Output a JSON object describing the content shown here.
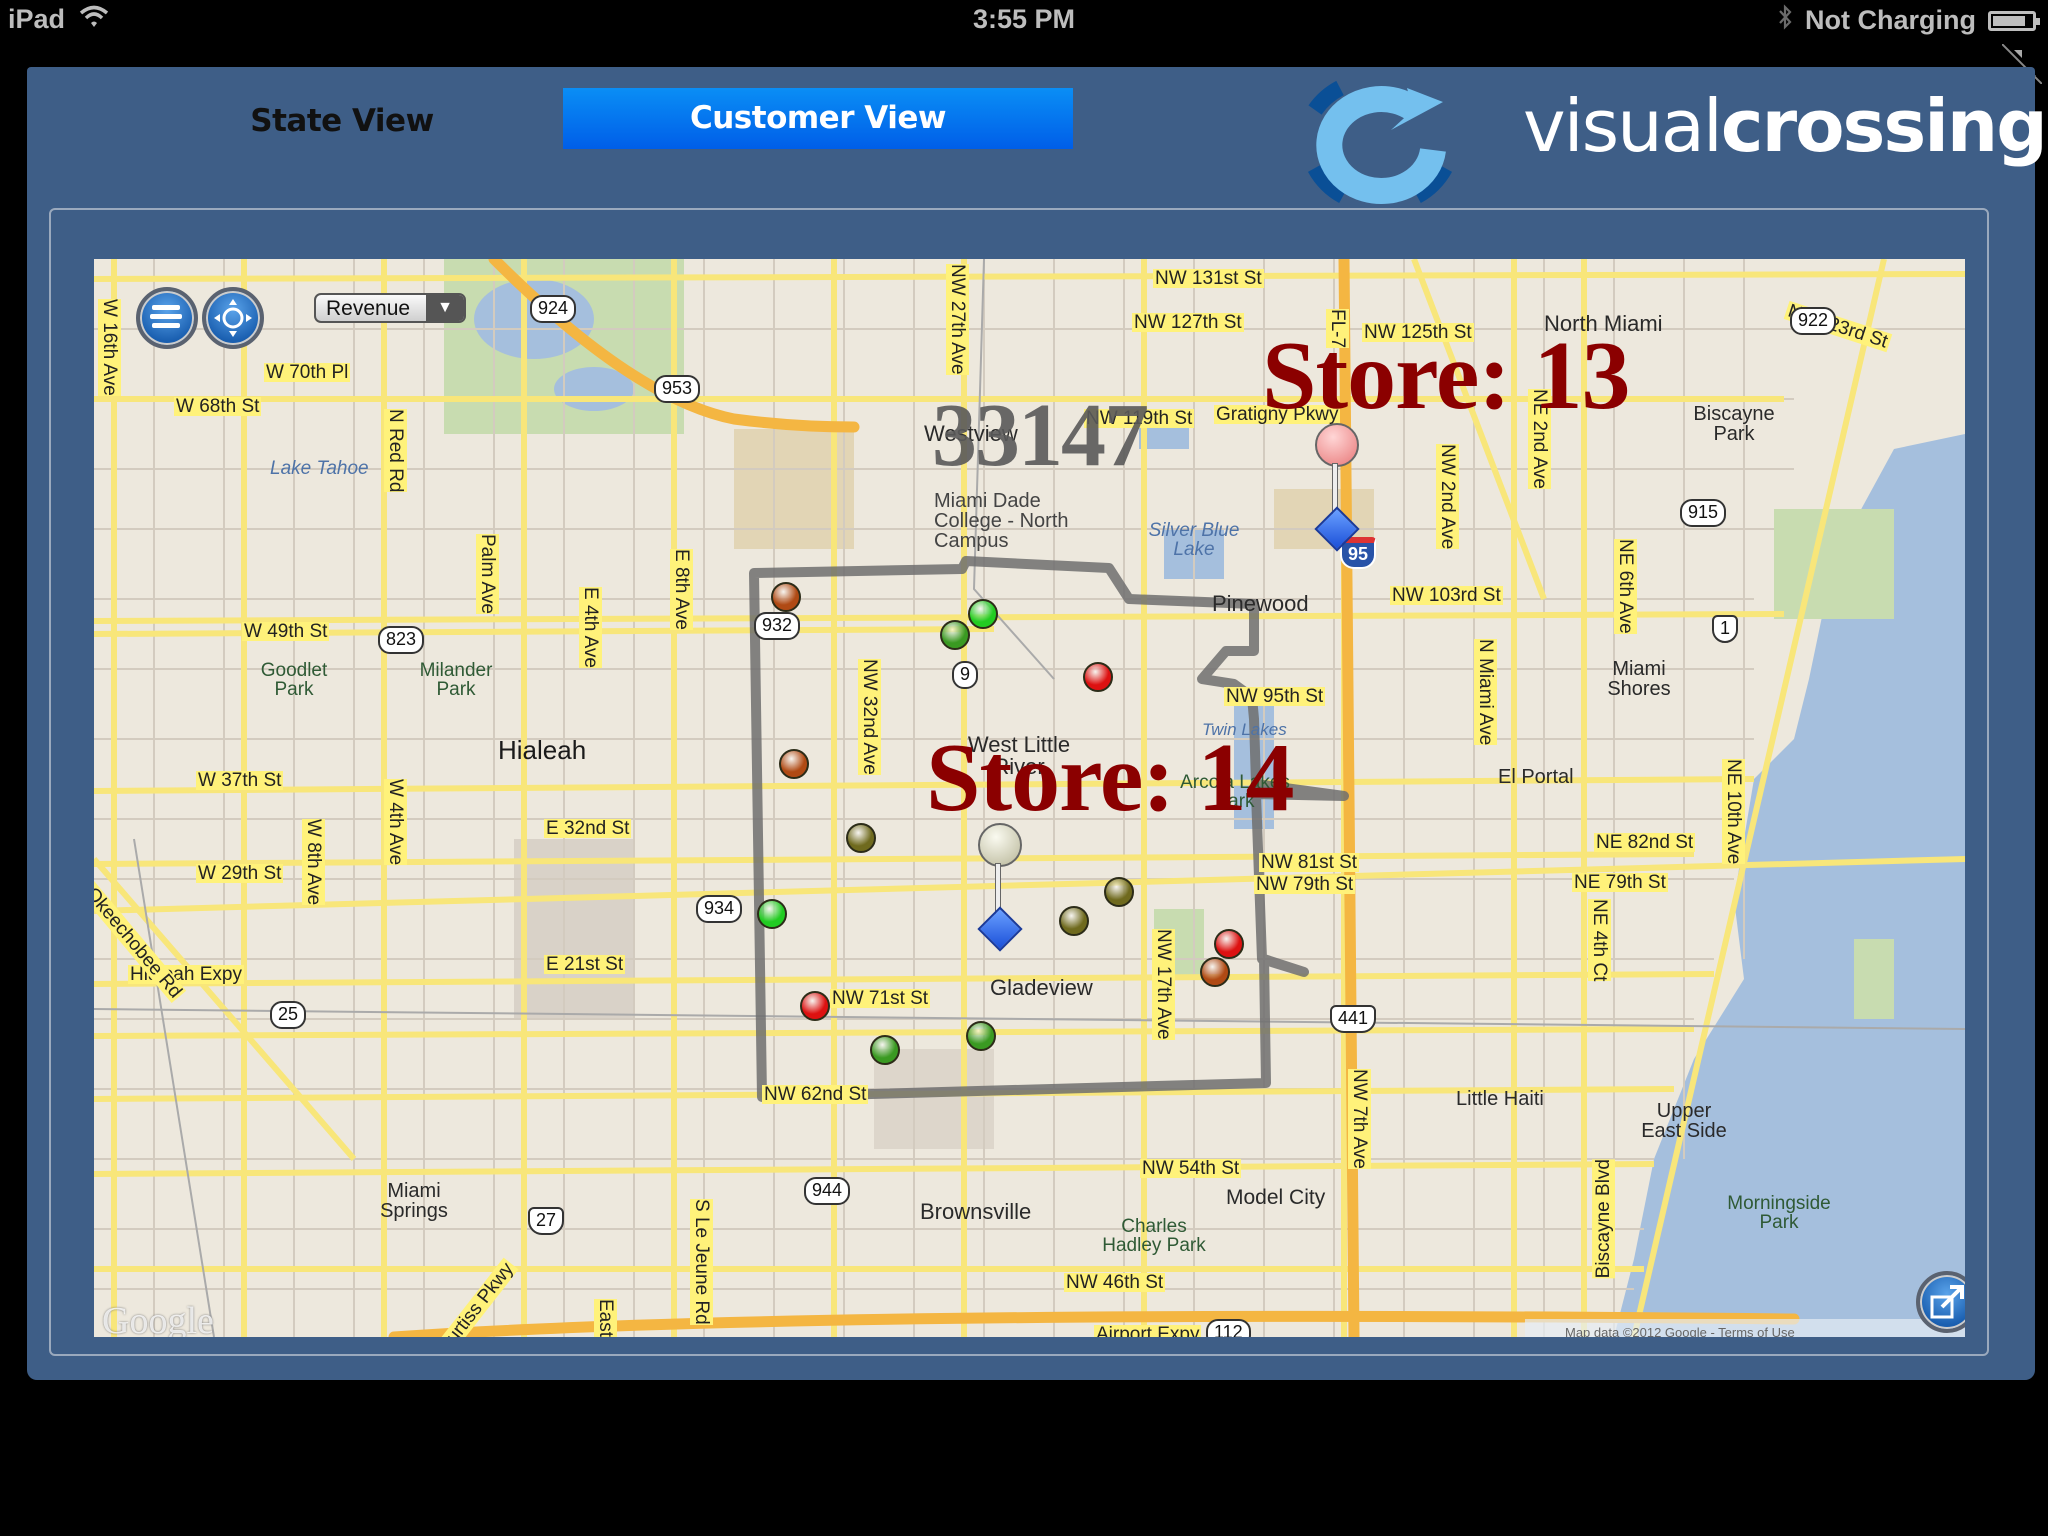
{
  "status_bar": {
    "device": "iPad",
    "time": "3:55 PM",
    "charging_status": "Not Charging",
    "icons": [
      "wifi-icon",
      "bluetooth-icon",
      "battery-icon"
    ]
  },
  "header": {
    "tabs": [
      {
        "label": "State View",
        "active": false
      },
      {
        "label": "Customer View",
        "active": true
      }
    ],
    "logo": {
      "text_light": "visual",
      "text_bold": "crossing"
    },
    "accent_color": "#0a7af0",
    "panel_color": "#3e5e87"
  },
  "map_controls": {
    "layers_button": "layers-icon",
    "locate_button": "locate-icon",
    "metric_select": {
      "selected": "Revenue"
    },
    "expand_button": "expand-icon",
    "google_logo": "Google",
    "attribution": "Map data ©2012 Google - Terms of Use"
  },
  "overlays": {
    "zip_code": "33147",
    "stores": [
      {
        "label": "Store: 13",
        "pin_color": "#f08080"
      },
      {
        "label": "Store: 14",
        "pin_color": "#d8d8c0"
      }
    ],
    "customer_markers": [
      {
        "status": "brown"
      },
      {
        "status": "bright-green"
      },
      {
        "status": "green"
      },
      {
        "status": "red"
      },
      {
        "status": "brown"
      },
      {
        "status": "olive"
      },
      {
        "status": "bright-green"
      },
      {
        "status": "olive"
      },
      {
        "status": "olive"
      },
      {
        "status": "red"
      },
      {
        "status": "brown"
      },
      {
        "status": "red"
      },
      {
        "status": "green"
      },
      {
        "status": "green"
      }
    ],
    "marker_colors": {
      "red": "#dd1111",
      "brown": "#b04a14",
      "olive": "#6f6a1e",
      "green": "#3a9a22",
      "bright-green": "#22cc22"
    }
  },
  "map_labels": {
    "places": [
      "North Miami",
      "Biscayne Park",
      "Miami Shores",
      "El Portal",
      "Hialeah",
      "West Little River",
      "Gladeview",
      "Pinewood",
      "Westview",
      "Little Haiti",
      "Upper East Side",
      "Model City",
      "Brownsville",
      "Miami Springs",
      "Miami Dade College - North Campus"
    ],
    "parks": [
      "Goodlet Park",
      "Milander Park",
      "Arcola Lakes Park",
      "Charles Hadley Park",
      "Morningside Park"
    ],
    "water": [
      "Lake Tahoe",
      "Silver Blue Lake",
      "Twin Lakes"
    ],
    "roads": [
      "NW 131st St",
      "NW 127th St",
      "NW 125th St",
      "NE 123rd St",
      "NW 119th St",
      "Gratigny Pkwy",
      "NW 103rd St",
      "NW 95th St",
      "NW 81st St",
      "NW 79th St",
      "NE 79th St",
      "NE 82nd St",
      "NW 71st St",
      "NW 62nd St",
      "NW 54th St",
      "NW 46th St",
      "W 70th Pl",
      "W 68th St",
      "W 49th St",
      "W 37th St",
      "W 29th St",
      "E 32nd St",
      "E 21st St",
      "Hialeah Expy",
      "S Okeechobee Rd",
      "Airport Expy",
      "Curtiss Pkwy",
      "Biscayne Blvd",
      "W 16th Ave",
      "N Red Rd",
      "Palm Ave",
      "E 4th Ave",
      "E 8th Ave",
      "W 4th Ave",
      "W 8th Ave",
      "NW 32nd Ave",
      "NW 27th Ave",
      "NW 17th Ave",
      "NW 7th Ave",
      "NW 2nd Ave",
      "NE 2nd Ave",
      "NE 6th Ave",
      "NE 4th Ct",
      "NE 10th Ave",
      "N Miami Ave",
      "FL-7",
      "S Le Jeune Rd",
      "East"
    ],
    "shields": [
      "924",
      "953",
      "932",
      "823",
      "934",
      "944",
      "25",
      "27",
      "9",
      "915",
      "922",
      "1",
      "441",
      "95",
      "112"
    ]
  }
}
